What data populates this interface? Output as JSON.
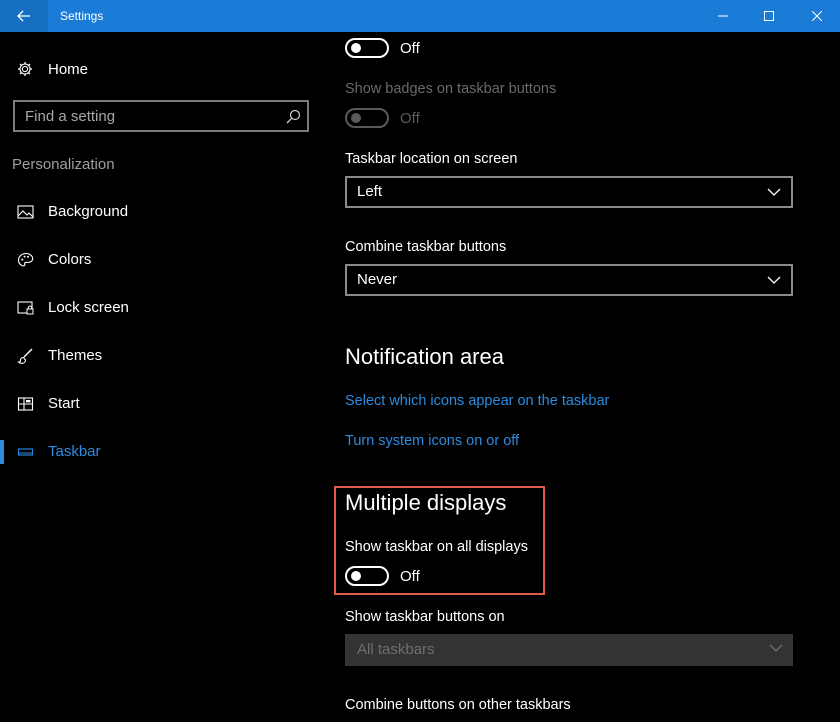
{
  "window": {
    "title": "Settings"
  },
  "sidebar": {
    "home_label": "Home",
    "search_placeholder": "Find a setting",
    "section_label": "Personalization",
    "items": [
      {
        "label": "Background",
        "icon": "picture-icon"
      },
      {
        "label": "Colors",
        "icon": "palette-icon"
      },
      {
        "label": "Lock screen",
        "icon": "lock-screen-icon"
      },
      {
        "label": "Themes",
        "icon": "brush-icon"
      },
      {
        "label": "Start",
        "icon": "start-grid-icon"
      },
      {
        "label": "Taskbar",
        "icon": "taskbar-icon",
        "active": true
      }
    ]
  },
  "content": {
    "top_toggle": {
      "state": "Off"
    },
    "badges": {
      "label": "Show badges on taskbar buttons",
      "state": "Off",
      "disabled": true
    },
    "location": {
      "label": "Taskbar location on screen",
      "value": "Left"
    },
    "combine": {
      "label": "Combine taskbar buttons",
      "value": "Never"
    },
    "notification_area": {
      "heading": "Notification area",
      "link1": "Select which icons appear on the taskbar",
      "link2": "Turn system icons on or off"
    },
    "multiple_displays": {
      "heading": "Multiple displays",
      "show_all_label": "Show taskbar on all displays",
      "show_all_state": "Off",
      "buttons_on_label": "Show taskbar buttons on",
      "buttons_on_value": "All taskbars",
      "combine_other_label": "Combine buttons on other taskbars"
    }
  },
  "colors": {
    "accent": "#2d8ce0",
    "titlebar": "#1a7cd6",
    "highlight": "#e05a4e"
  }
}
